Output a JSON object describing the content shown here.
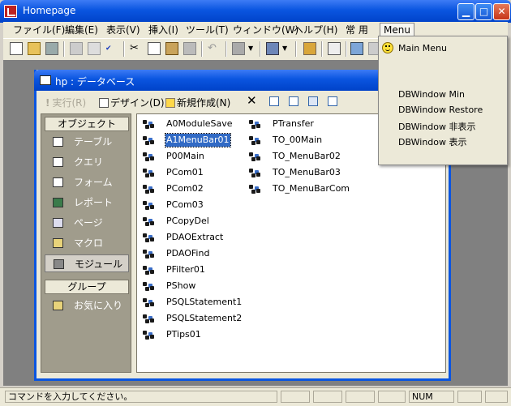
{
  "window": {
    "title": "Homepage"
  },
  "menubar": {
    "items": [
      "ファイル(F)",
      "編集(E)",
      "表示(V)",
      "挿入(I)",
      "ツール(T)",
      "ウィンドウ(W)",
      "ヘルプ(H)",
      "常 用",
      "Menu"
    ]
  },
  "popup_menu": {
    "items": [
      "Main Menu",
      "DBWindow Min",
      "DBWindow Restore",
      "DBWindow 非表示",
      "DBWindow 表示"
    ]
  },
  "db_window": {
    "title": "hp : データベース",
    "toolbar": {
      "run_label": "実行(R)",
      "design_label": "デザイン(D)",
      "new_label": "新規作成(N)"
    },
    "objects_header": "オブジェクト",
    "objects": [
      "テーブル",
      "クエリ",
      "フォーム",
      "レポート",
      "ページ",
      "マクロ",
      "モジュール"
    ],
    "selected_object": "モジュール",
    "groups_header": "グループ",
    "groups": [
      "お気に入り"
    ],
    "modules_col1": [
      "A0ModuleSave",
      "A1MenuBar01",
      "P00Main",
      "PCom01",
      "PCom02",
      "PCom03",
      "PCopyDel",
      "PDAOExtract",
      "PDAOFind",
      "PFilter01",
      "PShow",
      "PSQLStatement1",
      "PSQLStatement2",
      "PTips01"
    ],
    "modules_col2": [
      "PTransfer",
      "TO_00Main",
      "TO_MenuBar02",
      "TO_MenuBar03",
      "TO_MenuBarCom"
    ],
    "selected_module": "A1MenuBar01"
  },
  "statusbar": {
    "message": "コマンドを入力してください。",
    "num": "NUM"
  }
}
